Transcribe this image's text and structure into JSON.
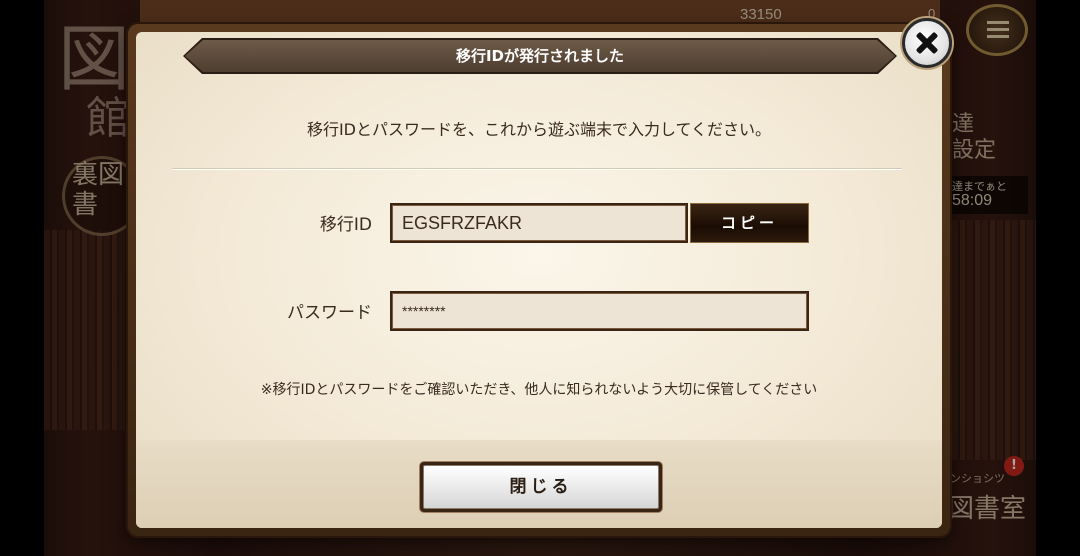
{
  "background": {
    "currency_count": "33150",
    "top_right_count": "0",
    "ura_label": "裏図書",
    "settings_label": "達\n設定",
    "timer_caption": "達までぁと",
    "timer": "58:09",
    "library_label": "図書室",
    "library_small": "ンショシツ",
    "notification_badge": "!",
    "kanji_big": "図",
    "kanji_side": "館"
  },
  "dialog": {
    "title": "移行IDが発行されました",
    "instruction": "移行IDとパスワードを、これから遊ぶ端末で入力してください。",
    "id_label": "移行ID",
    "id_value": "EGSFRZFAKR",
    "copy_label": "コピー",
    "password_label": "パスワード",
    "password_value": "********",
    "notice": "※移行IDとパスワードをご確認いただき、他人に知られないよう大切に保管してください",
    "close_label": "閉じる"
  },
  "icons": {
    "close": "close-icon",
    "menu": "menu-icon"
  },
  "colors": {
    "dialog_frame": "#5a3a1e",
    "ribbon": "#5e4a3a",
    "copy_button": "#1a0c04",
    "badge": "#c8281e"
  }
}
